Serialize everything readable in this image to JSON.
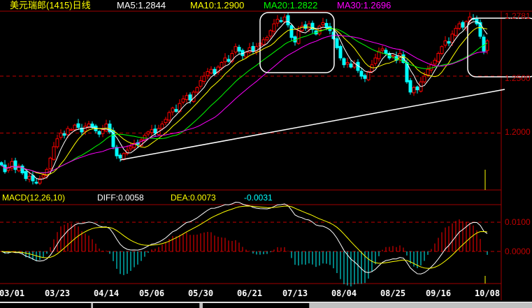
{
  "header": {
    "title": "美元瑞郎(1415)日线",
    "ma5": "MA5:1.2844",
    "ma10": "MA10:1.2900",
    "ma20": "MA20:1.2822",
    "ma30": "MA30:1.2696"
  },
  "macd_header": {
    "label": "MACD(12,26,10)",
    "diff": "DIFF:0.0058",
    "dea": "DEA:0.0073",
    "macd": "-0.0031"
  },
  "colors": {
    "up": "#ff0000",
    "down": "#00ffff",
    "ma5": "#ffffff",
    "ma10": "#ffff00",
    "ma20": "#00ff00",
    "ma30": "#ff00ff",
    "grid": "#c00000",
    "axis": "#a00000"
  },
  "chart_data": [
    {
      "type": "candlestick",
      "title": "美元瑞郎(1415)日线",
      "price_labels": [
        "1.2781",
        "1.2500",
        "1.2000"
      ],
      "ylim": [
        1.15,
        1.3065
      ],
      "gridlines": [
        1.25,
        1.2
      ],
      "moving_averages": [
        5,
        10,
        20,
        30
      ],
      "xticks": [
        {
          "label": "03/01",
          "index": 3
        },
        {
          "label": "03/23",
          "index": 16
        },
        {
          "label": "04/14",
          "index": 30
        },
        {
          "label": "05/06",
          "index": 43
        },
        {
          "label": "05/30",
          "index": 57
        },
        {
          "label": "06/21",
          "index": 71
        },
        {
          "label": "07/13",
          "index": 84
        },
        {
          "label": "08/04",
          "index": 98
        },
        {
          "label": "08/25",
          "index": 112
        },
        {
          "label": "09/16",
          "index": 125
        },
        {
          "label": "10/08",
          "index": 139
        }
      ],
      "close": [
        1.172,
        1.166,
        1.17,
        1.175,
        1.168,
        1.171,
        1.165,
        1.16,
        1.162,
        1.158,
        1.156,
        1.16,
        1.163,
        1.168,
        1.178,
        1.188,
        1.195,
        1.2,
        1.198,
        1.204,
        1.203,
        1.207,
        1.205,
        1.201,
        1.206,
        1.208,
        1.205,
        1.202,
        1.199,
        1.203,
        1.208,
        1.201,
        1.188,
        1.18,
        1.178,
        1.182,
        1.185,
        1.188,
        1.191,
        1.19,
        1.194,
        1.198,
        1.201,
        1.203,
        1.2,
        1.204,
        1.208,
        1.212,
        1.218,
        1.222,
        1.219,
        1.226,
        1.23,
        1.233,
        1.229,
        1.236,
        1.24,
        1.246,
        1.25,
        1.254,
        1.256,
        1.252,
        1.258,
        1.262,
        1.266,
        1.263,
        1.27,
        1.276,
        1.272,
        1.268,
        1.271,
        1.275,
        1.272,
        1.276,
        1.279,
        1.282,
        1.284,
        1.29,
        1.296,
        1.3,
        1.298,
        1.302,
        1.295,
        1.284,
        1.28,
        1.29,
        1.294,
        1.292,
        1.296,
        1.291,
        1.287,
        1.294,
        1.297,
        1.293,
        1.29,
        1.283,
        1.275,
        1.266,
        1.26,
        1.262,
        1.258,
        1.261,
        1.255,
        1.25,
        1.248,
        1.254,
        1.26,
        1.266,
        1.272,
        1.274,
        1.27,
        1.266,
        1.268,
        1.264,
        1.27,
        1.262,
        1.245,
        1.236,
        1.24,
        1.238,
        1.245,
        1.25,
        1.256,
        1.26,
        1.264,
        1.27,
        1.276,
        1.281,
        1.279,
        1.287,
        1.292,
        1.296,
        1.293,
        1.298,
        1.302,
        1.3,
        1.296,
        1.285,
        1.272,
        1.281
      ],
      "annotations": [
        "rounded-box-top-july",
        "rounded-box-latest",
        "support-trendline"
      ]
    },
    {
      "type": "bar-line",
      "title": "MACD(12,26,10)",
      "series": [
        {
          "name": "DIFF"
        },
        {
          "name": "DEA"
        },
        {
          "name": "MACD"
        }
      ],
      "price_labels": [
        "0.0100",
        "0.0000"
      ],
      "ylim": [
        -0.011,
        0.016
      ],
      "gridlines": [
        0.01,
        0.0
      ]
    }
  ]
}
